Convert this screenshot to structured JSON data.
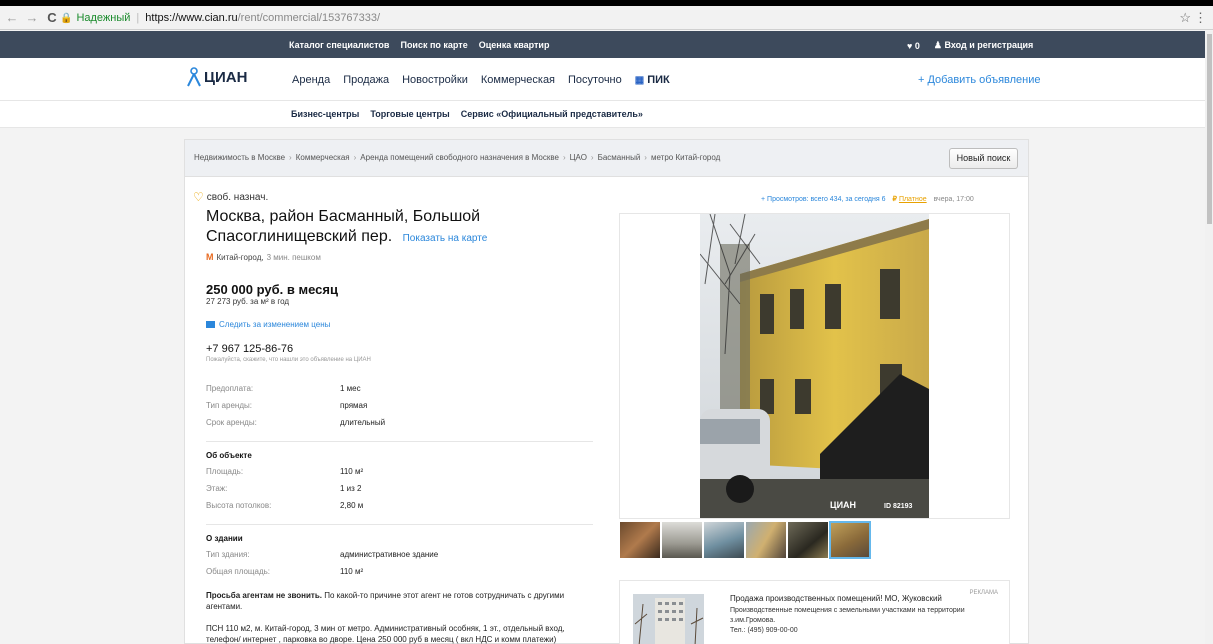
{
  "browser": {
    "back": "←",
    "forward": "→",
    "reload": "C",
    "secure_label": "Надежный",
    "url_host": "https://www.cian.ru",
    "url_path": "/rent/commercial/153767333/",
    "star": "☆",
    "menu": "⋮"
  },
  "topbar": {
    "links": [
      "Каталог специалистов",
      "Поиск по карте",
      "Оценка квартир"
    ],
    "favorites_count": "0",
    "login": "Вход и регистрация"
  },
  "nav": {
    "logo": "ЦИАН",
    "items": [
      "Аренда",
      "Продажа",
      "Новостройки",
      "Коммерческая",
      "Посуточно"
    ],
    "pik": "ПИК",
    "add_listing": "+ Добавить объявление"
  },
  "subnav": {
    "items": [
      "Бизнес-центры",
      "Торговые центры",
      "Сервис «Официальный представитель»"
    ]
  },
  "breadcrumbs": [
    "Недвижимость в Москве",
    "Коммерческая",
    "Аренда помещений свободного назначения в Москве",
    "ЦАО",
    "Басманный",
    "метро Китай-город"
  ],
  "new_search": "Новый поиск",
  "listing": {
    "type": "своб. назнач.",
    "address": "Москва, район Басманный, Большой Спасоглинищевский пер.",
    "show_on_map": "Показать на карте",
    "metro": "Китай-город,",
    "metro_walk": "3 мин. пешком",
    "price": "250 000 руб. в месяц",
    "price_per_m2": "27 273 руб. за м² в год",
    "follow_price": "Следить за изменением цены",
    "phone": "+7 967 125-86-76",
    "phone_note": "Пожалуйста, скажите, что нашли это объявление на ЦИАН",
    "terms": [
      {
        "k": "Предоплата:",
        "v": "1 мес"
      },
      {
        "k": "Тип аренды:",
        "v": "прямая"
      },
      {
        "k": "Срок аренды:",
        "v": "длительный"
      }
    ],
    "object_title": "Об объекте",
    "object": [
      {
        "k": "Площадь:",
        "v": "110 м²"
      },
      {
        "k": "Этаж:",
        "v": "1 из 2"
      },
      {
        "k": "Высота потолков:",
        "v": "2,80 м"
      }
    ],
    "building_title": "О здании",
    "building": [
      {
        "k": "Тип здания:",
        "v": "административное здание"
      },
      {
        "k": "Общая площадь:",
        "v": "110 м²"
      }
    ],
    "desc_bold": "Просьба агентам не звонить.",
    "desc_rest": "По какой-то причине этот агент не готов сотрудничать с другими агентами.",
    "desc_2": "ПСН 110 м2, м. Китай-город, 3 мин от метро. Административный особняк, 1 эт., отдельный вход, телефон/ интернет , парковка во дворе. Цена 250 000 руб в месяц ( вкл НДС и комм платежи)"
  },
  "stats": {
    "views": "Просмотров: всего 434, за сегодня 6",
    "paid": "Платное",
    "time": "вчера, 17:00"
  },
  "photo": {
    "watermark": "ЦИАН",
    "id": "ID 82193"
  },
  "ad": {
    "title": "Продажа производственных помещений! МО, Жуковский",
    "body": "Производственные помещения с земельными участками на территории з.им.Громова.",
    "phone": "Тел.: (495) 909-00-00",
    "tag": "РЕКЛАМА"
  }
}
